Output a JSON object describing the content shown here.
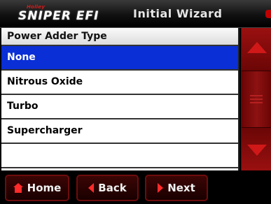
{
  "header": {
    "logo_brand": "Holley",
    "logo_product": "SNIPER EFI",
    "title": "Initial Wizard"
  },
  "list": {
    "heading": "Power Adder Type",
    "items": [
      {
        "label": "None",
        "selected": true
      },
      {
        "label": "Nitrous Oxide",
        "selected": false
      },
      {
        "label": "Turbo",
        "selected": false
      },
      {
        "label": "Supercharger",
        "selected": false
      },
      {
        "label": "",
        "selected": false
      }
    ]
  },
  "footer": {
    "home_label": "Home",
    "back_label": "Back",
    "next_label": "Next"
  },
  "colors": {
    "selected_row": "#0a2fd6",
    "accent_red": "#d01818",
    "button_bg": "#2a0202"
  }
}
